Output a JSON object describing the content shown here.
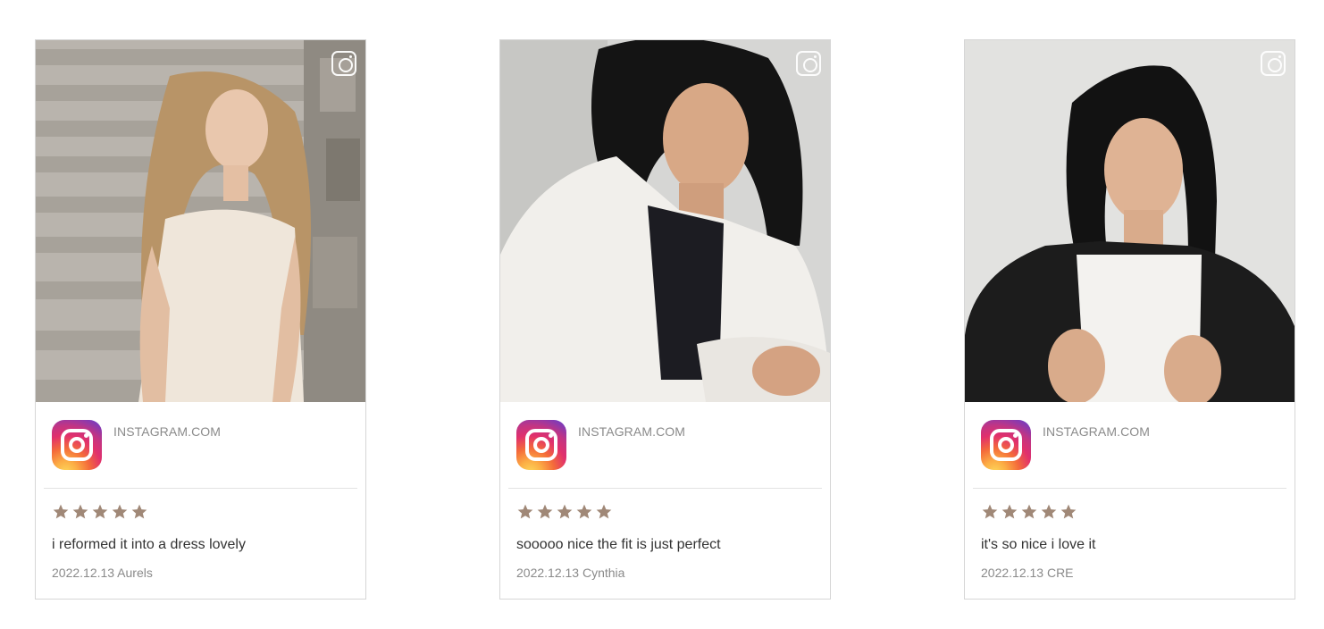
{
  "reviews": [
    {
      "source": "INSTAGRAM.COM",
      "rating": 5,
      "text": "i reformed it into a dress lovely",
      "date": "2022.12.13",
      "author": "Aurels",
      "meta": "2022.12.13 Aurels"
    },
    {
      "source": "INSTAGRAM.COM",
      "rating": 5,
      "text": "sooooo nice the fit is just perfect",
      "date": "2022.12.13",
      "author": "Cynthia",
      "meta": "2022.12.13 Cynthia"
    },
    {
      "source": "INSTAGRAM.COM",
      "rating": 5,
      "text": "it's so nice i love it",
      "date": "2022.12.13",
      "author": "CRE",
      "meta": "2022.12.13 CRE"
    }
  ],
  "icons": {
    "corner": "instagram-outline-icon",
    "logo": "instagram-logo-icon",
    "star": "star-icon"
  },
  "colors": {
    "star": "#a08877",
    "border": "#d6d6d6",
    "text": "#333333",
    "muted": "#8a8a8a"
  }
}
